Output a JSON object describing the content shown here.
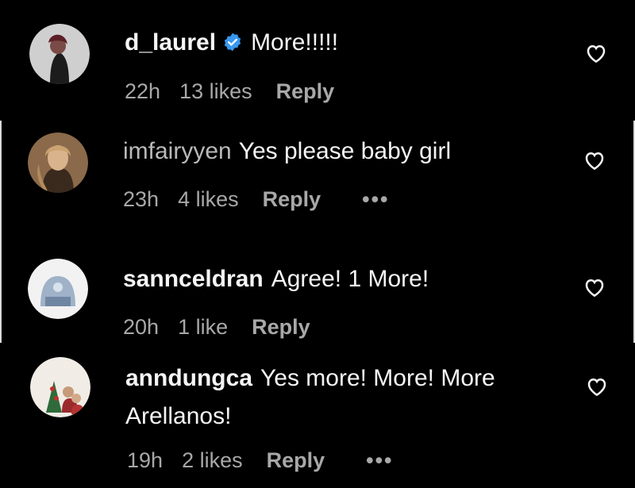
{
  "comments": [
    {
      "username": "d_laurel",
      "verified": true,
      "text": "More!!!!!",
      "time": "22h",
      "likes": "13 likes",
      "reply": "Reply"
    },
    {
      "username": "imfairyyen",
      "text": "Yes please baby girl",
      "time": "23h",
      "likes": "4 likes",
      "reply": "Reply",
      "more": "•••"
    },
    {
      "username": "sannceldran",
      "text": "Agree! 1 More!",
      "time": "20h",
      "likes": "1 like",
      "reply": "Reply"
    },
    {
      "username": "anndungca",
      "text_line1": "Yes more! More! More",
      "text_line2": "Arellanos!",
      "time": "19h",
      "likes": "2 likes",
      "reply": "Reply",
      "more": "•••"
    }
  ],
  "icons": {
    "heart": "heart-icon",
    "verified": "verified-badge-icon",
    "more": "more-options-icon"
  },
  "colors": {
    "background": "#000000",
    "text": "#f5f5f5",
    "muted": "#a8a8a8",
    "verified": "#3897f0"
  }
}
